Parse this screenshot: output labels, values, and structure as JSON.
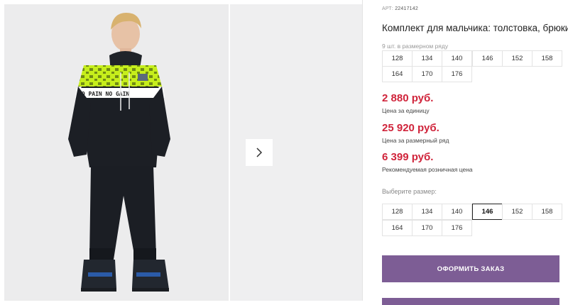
{
  "gallery": {
    "next_icon": "chevron-right-icon"
  },
  "product": {
    "sku_label": "АРТ:",
    "sku_value": "22417142",
    "title": "Комплект для мальчика: толстовка, брюки",
    "row_note": "9 шт. в размерном ряду",
    "row_sizes": [
      "128",
      "134",
      "140",
      "146",
      "152",
      "158",
      "164",
      "170",
      "176"
    ],
    "prices": [
      {
        "value": "2 880 руб.",
        "label": "Цена за единицу"
      },
      {
        "value": "25 920 руб.",
        "label": "Цена за размерный ряд"
      },
      {
        "value": "6 399 руб.",
        "label": "Рекомендуемая розничная цена"
      }
    ],
    "choose_label": "Выберите размер:",
    "choose_sizes": [
      "128",
      "134",
      "140",
      "146",
      "152",
      "158",
      "164",
      "170",
      "176"
    ],
    "selected_size": "146",
    "order_button": "ОФОРМИТЬ ЗАКАЗ"
  },
  "colors": {
    "price": "#d0243b",
    "button": "#7d5d95",
    "hoodie_accent": "#c6ee1c"
  }
}
